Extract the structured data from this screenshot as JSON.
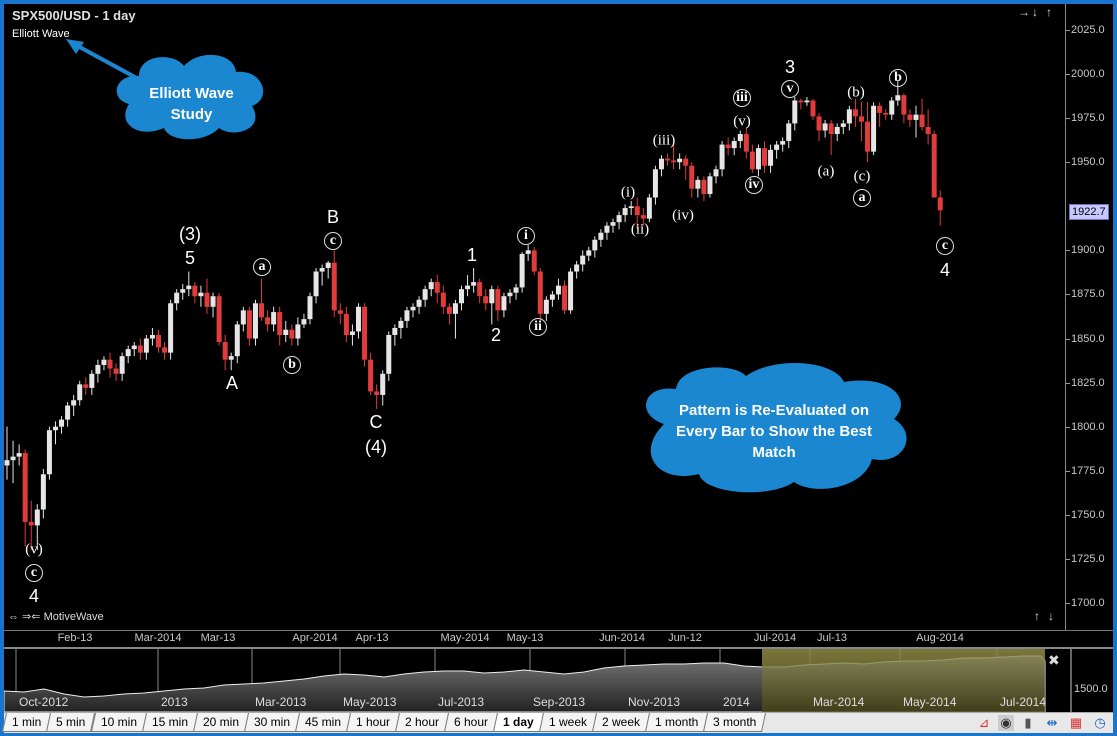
{
  "header": {
    "title": "SPX500/USD - 1 day",
    "study_label": "Elliott Wave",
    "nav_top": [
      "→",
      "↓",
      "↑"
    ],
    "nav_bottom_right": [
      "↑",
      "↓"
    ],
    "brand": "MotiveWave",
    "brand_icons": "⇔ ⇒⇐"
  },
  "callouts": [
    {
      "text": "Elliott Wave Study",
      "color": "#1a87d0"
    },
    {
      "text": "Pattern is Re-Evaluated on Every Bar to Show the Best Match",
      "color": "#1a87d0"
    }
  ],
  "price_axis": {
    "ticks": [
      "2025.0",
      "2000.0",
      "1975.0",
      "1950.0",
      "1900.0",
      "1875.0",
      "1850.0",
      "1825.0",
      "1800.0",
      "1775.0",
      "1750.0",
      "1725.0",
      "1700.0"
    ],
    "last_price": "1922.7"
  },
  "time_axis": [
    "Feb-13",
    "Mar-2014",
    "Mar-13",
    "Apr-2014",
    "Apr-13",
    "May-2014",
    "May-13",
    "Jun-2014",
    "Jun-12",
    "Jul-2014",
    "Jul-13",
    "Aug-2014"
  ],
  "chart_data": {
    "type": "candlestick",
    "title": "SPX500/USD - 1 day",
    "ylim": [
      1683,
      2037
    ],
    "colors": {
      "up": "#e6e6e6",
      "down": "#e03c3c"
    },
    "ohlc": [
      [
        1778,
        1800,
        1770,
        1781
      ],
      [
        1781,
        1792,
        1768,
        1783
      ],
      [
        1783,
        1790,
        1778,
        1785
      ],
      [
        1785,
        1787,
        1732,
        1746
      ],
      [
        1746,
        1758,
        1730,
        1744
      ],
      [
        1744,
        1756,
        1730,
        1753
      ],
      [
        1753,
        1776,
        1748,
        1773
      ],
      [
        1773,
        1800,
        1770,
        1798
      ],
      [
        1798,
        1803,
        1790,
        1800
      ],
      [
        1800,
        1806,
        1796,
        1804
      ],
      [
        1804,
        1814,
        1800,
        1812
      ],
      [
        1812,
        1818,
        1806,
        1815
      ],
      [
        1815,
        1826,
        1812,
        1824
      ],
      [
        1824,
        1828,
        1818,
        1822
      ],
      [
        1822,
        1832,
        1818,
        1830
      ],
      [
        1830,
        1838,
        1825,
        1835
      ],
      [
        1835,
        1840,
        1832,
        1838
      ],
      [
        1838,
        1842,
        1828,
        1833
      ],
      [
        1833,
        1836,
        1826,
        1830
      ],
      [
        1830,
        1842,
        1826,
        1840
      ],
      [
        1840,
        1846,
        1836,
        1844
      ],
      [
        1844,
        1848,
        1840,
        1846
      ],
      [
        1846,
        1850,
        1838,
        1842
      ],
      [
        1842,
        1852,
        1838,
        1850
      ],
      [
        1850,
        1856,
        1846,
        1852
      ],
      [
        1852,
        1855,
        1842,
        1845
      ],
      [
        1845,
        1848,
        1838,
        1842
      ],
      [
        1842,
        1872,
        1838,
        1870
      ],
      [
        1870,
        1878,
        1866,
        1876
      ],
      [
        1876,
        1881,
        1872,
        1878
      ],
      [
        1878,
        1888,
        1874,
        1880
      ],
      [
        1880,
        1882,
        1870,
        1874
      ],
      [
        1874,
        1880,
        1868,
        1876
      ],
      [
        1876,
        1884,
        1864,
        1868
      ],
      [
        1868,
        1876,
        1862,
        1874
      ],
      [
        1874,
        1876,
        1846,
        1848
      ],
      [
        1848,
        1852,
        1832,
        1838
      ],
      [
        1838,
        1842,
        1832,
        1840
      ],
      [
        1840,
        1860,
        1836,
        1858
      ],
      [
        1858,
        1868,
        1854,
        1866
      ],
      [
        1866,
        1868,
        1846,
        1850
      ],
      [
        1850,
        1872,
        1846,
        1870
      ],
      [
        1870,
        1884,
        1860,
        1862
      ],
      [
        1862,
        1866,
        1854,
        1858
      ],
      [
        1858,
        1868,
        1854,
        1865
      ],
      [
        1865,
        1868,
        1846,
        1852
      ],
      [
        1852,
        1860,
        1848,
        1855
      ],
      [
        1855,
        1858,
        1846,
        1850
      ],
      [
        1850,
        1862,
        1846,
        1858
      ],
      [
        1858,
        1864,
        1856,
        1861
      ],
      [
        1861,
        1876,
        1858,
        1874
      ],
      [
        1874,
        1890,
        1870,
        1888
      ],
      [
        1888,
        1892,
        1880,
        1890
      ],
      [
        1890,
        1894,
        1884,
        1893
      ],
      [
        1893,
        1900,
        1862,
        1866
      ],
      [
        1866,
        1870,
        1858,
        1864
      ],
      [
        1864,
        1868,
        1848,
        1852
      ],
      [
        1852,
        1858,
        1846,
        1854
      ],
      [
        1854,
        1870,
        1850,
        1868
      ],
      [
        1868,
        1870,
        1834,
        1838
      ],
      [
        1838,
        1842,
        1818,
        1820
      ],
      [
        1820,
        1824,
        1810,
        1818
      ],
      [
        1818,
        1832,
        1812,
        1830
      ],
      [
        1830,
        1854,
        1826,
        1852
      ],
      [
        1852,
        1858,
        1846,
        1856
      ],
      [
        1856,
        1862,
        1850,
        1860
      ],
      [
        1860,
        1868,
        1856,
        1866
      ],
      [
        1866,
        1870,
        1862,
        1868
      ],
      [
        1868,
        1874,
        1864,
        1872
      ],
      [
        1872,
        1880,
        1868,
        1878
      ],
      [
        1878,
        1884,
        1874,
        1882
      ],
      [
        1882,
        1886,
        1870,
        1876
      ],
      [
        1876,
        1880,
        1864,
        1868
      ],
      [
        1868,
        1870,
        1858,
        1864
      ],
      [
        1864,
        1872,
        1850,
        1870
      ],
      [
        1870,
        1880,
        1866,
        1878
      ],
      [
        1878,
        1886,
        1874,
        1880
      ],
      [
        1880,
        1890,
        1876,
        1882
      ],
      [
        1882,
        1884,
        1870,
        1874
      ],
      [
        1874,
        1878,
        1866,
        1870
      ],
      [
        1870,
        1880,
        1858,
        1878
      ],
      [
        1878,
        1880,
        1860,
        1866
      ],
      [
        1866,
        1876,
        1862,
        1874
      ],
      [
        1874,
        1878,
        1870,
        1876
      ],
      [
        1876,
        1881,
        1872,
        1879
      ],
      [
        1879,
        1899,
        1876,
        1898
      ],
      [
        1898,
        1903,
        1894,
        1900
      ],
      [
        1900,
        1902,
        1886,
        1888
      ],
      [
        1888,
        1890,
        1860,
        1864
      ],
      [
        1864,
        1874,
        1860,
        1872
      ],
      [
        1872,
        1877,
        1868,
        1875
      ],
      [
        1875,
        1884,
        1872,
        1880
      ],
      [
        1880,
        1883,
        1864,
        1866
      ],
      [
        1866,
        1890,
        1864,
        1888
      ],
      [
        1888,
        1894,
        1884,
        1892
      ],
      [
        1892,
        1900,
        1888,
        1897
      ],
      [
        1897,
        1902,
        1894,
        1900
      ],
      [
        1900,
        1908,
        1896,
        1906
      ],
      [
        1906,
        1912,
        1902,
        1910
      ],
      [
        1910,
        1916,
        1906,
        1914
      ],
      [
        1914,
        1918,
        1910,
        1916
      ],
      [
        1916,
        1922,
        1912,
        1920
      ],
      [
        1920,
        1926,
        1916,
        1924
      ],
      [
        1924,
        1928,
        1920,
        1925
      ],
      [
        1925,
        1930,
        1912,
        1920
      ],
      [
        1920,
        1924,
        1914,
        1918
      ],
      [
        1918,
        1932,
        1916,
        1930
      ],
      [
        1930,
        1948,
        1926,
        1946
      ],
      [
        1946,
        1954,
        1942,
        1952
      ],
      [
        1952,
        1955,
        1948,
        1951
      ],
      [
        1951,
        1960,
        1946,
        1950
      ],
      [
        1950,
        1955,
        1946,
        1952
      ],
      [
        1952,
        1954,
        1940,
        1948
      ],
      [
        1948,
        1950,
        1930,
        1935
      ],
      [
        1935,
        1942,
        1930,
        1940
      ],
      [
        1940,
        1942,
        1928,
        1932
      ],
      [
        1932,
        1944,
        1930,
        1942
      ],
      [
        1942,
        1948,
        1938,
        1946
      ],
      [
        1946,
        1962,
        1942,
        1960
      ],
      [
        1960,
        1964,
        1954,
        1958
      ],
      [
        1958,
        1964,
        1954,
        1962
      ],
      [
        1962,
        1968,
        1958,
        1966
      ],
      [
        1966,
        1970,
        1952,
        1956
      ],
      [
        1956,
        1960,
        1944,
        1946
      ],
      [
        1946,
        1960,
        1942,
        1958
      ],
      [
        1958,
        1962,
        1944,
        1948
      ],
      [
        1948,
        1960,
        1944,
        1957
      ],
      [
        1957,
        1962,
        1952,
        1960
      ],
      [
        1960,
        1964,
        1956,
        1962
      ],
      [
        1962,
        1974,
        1958,
        1972
      ],
      [
        1972,
        1987,
        1968,
        1985
      ],
      [
        1985,
        1986,
        1980,
        1984
      ],
      [
        1984,
        1987,
        1982,
        1985
      ],
      [
        1985,
        1986,
        1974,
        1976
      ],
      [
        1976,
        1978,
        1962,
        1968
      ],
      [
        1968,
        1974,
        1964,
        1972
      ],
      [
        1972,
        1974,
        1954,
        1966
      ],
      [
        1966,
        1972,
        1962,
        1970
      ],
      [
        1970,
        1974,
        1966,
        1972
      ],
      [
        1972,
        1982,
        1968,
        1980
      ],
      [
        1980,
        1986,
        1970,
        1976
      ],
      [
        1976,
        1984,
        1962,
        1973
      ],
      [
        1973,
        1984,
        1950,
        1956
      ],
      [
        1956,
        1984,
        1954,
        1982
      ],
      [
        1982,
        1984,
        1970,
        1978
      ],
      [
        1978,
        1980,
        1974,
        1977
      ],
      [
        1977,
        1987,
        1974,
        1985
      ],
      [
        1985,
        1996,
        1982,
        1988
      ],
      [
        1988,
        1989,
        1972,
        1977
      ],
      [
        1977,
        1980,
        1970,
        1974
      ],
      [
        1974,
        1982,
        1964,
        1977
      ],
      [
        1977,
        1986,
        1968,
        1970
      ],
      [
        1970,
        1980,
        1960,
        1966
      ],
      [
        1966,
        1968,
        1930,
        1930
      ],
      [
        1930,
        1934,
        1914,
        1922.7
      ]
    ],
    "annotations": [
      {
        "text": "(v)",
        "style": "paren"
      },
      {
        "text": "c",
        "style": "circle"
      },
      {
        "text": "4",
        "style": "plain"
      },
      {
        "text": "(3)",
        "style": "plain"
      },
      {
        "text": "5",
        "style": "plain"
      },
      {
        "text": "A",
        "style": "plain"
      },
      {
        "text": "a",
        "style": "circle"
      },
      {
        "text": "b",
        "style": "circle"
      },
      {
        "text": "B",
        "style": "plain"
      },
      {
        "text": "c",
        "style": "circle"
      },
      {
        "text": "C",
        "style": "plain"
      },
      {
        "text": "(4)",
        "style": "plain"
      },
      {
        "text": "1",
        "style": "plain"
      },
      {
        "text": "2",
        "style": "plain"
      },
      {
        "text": "i",
        "style": "circle"
      },
      {
        "text": "ii",
        "style": "circle"
      },
      {
        "text": "(i)",
        "style": "paren"
      },
      {
        "text": "(ii)",
        "style": "paren"
      },
      {
        "text": "(iii)",
        "style": "paren"
      },
      {
        "text": "(iv)",
        "style": "paren"
      },
      {
        "text": "iii",
        "style": "circle"
      },
      {
        "text": "(v)",
        "style": "paren"
      },
      {
        "text": "iv",
        "style": "circle"
      },
      {
        "text": "3",
        "style": "plain"
      },
      {
        "text": "v",
        "style": "circle"
      },
      {
        "text": "(a)",
        "style": "paren"
      },
      {
        "text": "(b)",
        "style": "paren"
      },
      {
        "text": "(c)",
        "style": "paren"
      },
      {
        "text": "a",
        "style": "circle"
      },
      {
        "text": "b",
        "style": "circle"
      },
      {
        "text": "c",
        "style": "circle"
      },
      {
        "text": "4",
        "style": "plain"
      }
    ]
  },
  "overview": {
    "labels": [
      "Oct-2012",
      "2013",
      "Mar-2013",
      "May-2013",
      "Jul-2013",
      "Sep-2013",
      "Nov-2013",
      "2014",
      "Mar-2014",
      "May-2014",
      "Jul-2014"
    ],
    "axis_label": "1500.0",
    "close_icon": "✖",
    "selection_color": "#3a3500"
  },
  "timeframes": {
    "items": [
      "1 min",
      "5 min",
      "10 min",
      "15 min",
      "20 min",
      "30 min",
      "45 min",
      "1 hour",
      "2 hour",
      "6 hour",
      "1 day",
      "1 week",
      "2 week",
      "1 month",
      "3 month"
    ],
    "selected": "1 day"
  }
}
